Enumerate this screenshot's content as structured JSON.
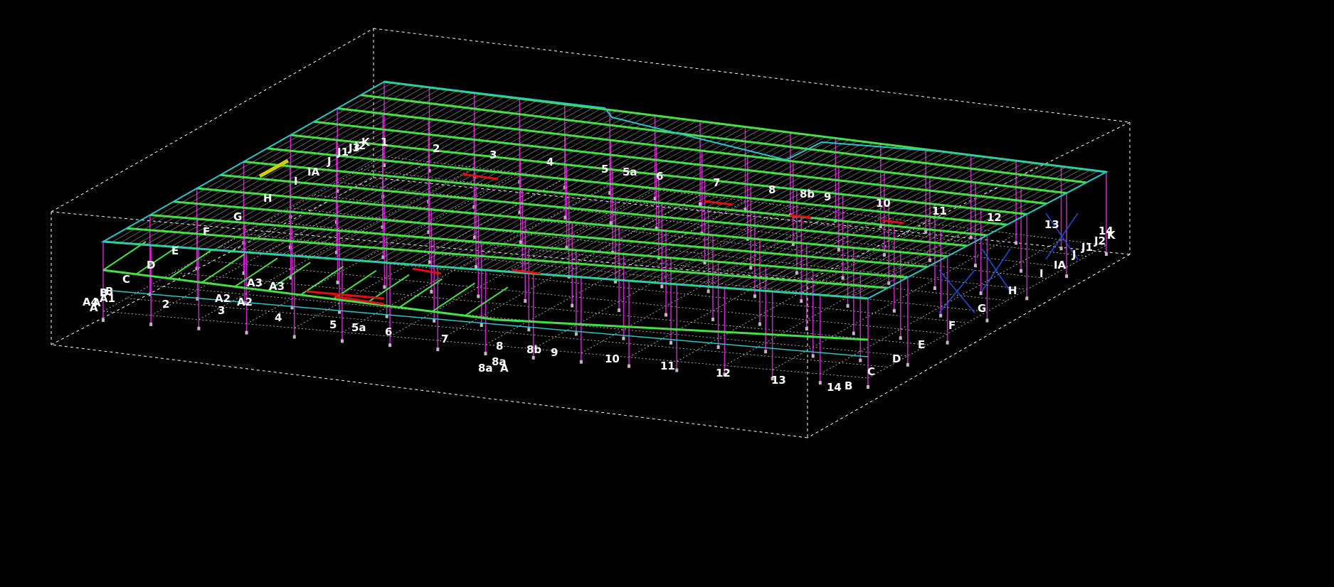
{
  "viewport": {
    "background": "#000000"
  },
  "colors": {
    "bounding_box": "#ffffff",
    "roof_beam": "#44e044",
    "roof_edge": "#25c8c8",
    "column": "#d020d0",
    "purlin": "#9a9a9a",
    "bracing": "#2050e0",
    "highlight_member": "#d0d000",
    "selected_member": "#e01010",
    "label": "#ffffff",
    "grid_line": "#cfcfcf"
  },
  "grid_labels": {
    "back_numbers": [
      "1",
      "2",
      "3",
      "4",
      "5",
      "5a",
      "6",
      "7",
      "8",
      "8b",
      "9",
      "10",
      "11",
      "12",
      "13",
      "14"
    ],
    "back_left_letters": [
      "K",
      "J3",
      "J2",
      "J1",
      "J",
      "IA",
      "I",
      "H",
      "G",
      "F",
      "E",
      "D",
      "C",
      "B",
      "A"
    ],
    "front_numbers": [
      "2",
      "3",
      "4",
      "5",
      "5a",
      "6",
      "7",
      "8",
      "8a",
      "8b",
      "9",
      "10",
      "11",
      "12",
      "13",
      "14"
    ],
    "front_left_letters": [
      "A4",
      "A1",
      "A",
      "B",
      "C",
      "D",
      "E"
    ],
    "front_annotations": [
      "A2",
      "A2",
      "A3",
      "A3",
      "8a",
      "A",
      "B"
    ],
    "right_letters": [
      "C",
      "D",
      "E",
      "F",
      "G",
      "H",
      "I",
      "IA",
      "J",
      "J1",
      "J2",
      "K"
    ]
  }
}
